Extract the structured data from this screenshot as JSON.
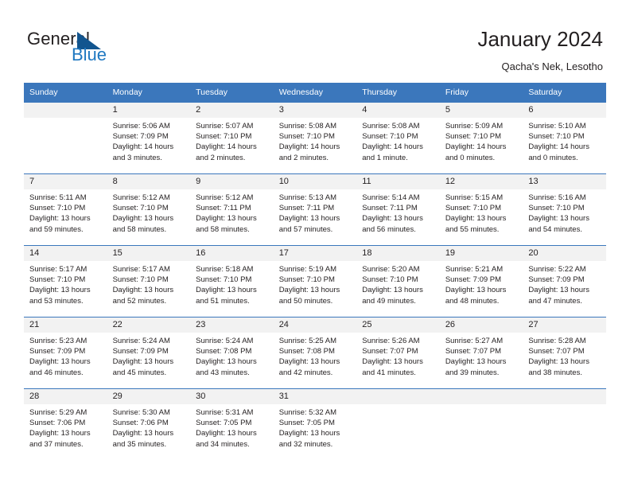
{
  "brand": {
    "word1": "General",
    "word2": "Blue",
    "triangle_color": "#12558f",
    "blue_color": "#1f78c1"
  },
  "header": {
    "title": "January 2024",
    "subtitle": "Qacha's Nek, Lesotho",
    "accent_color": "#3b77bc",
    "daynum_background": "#f2f2f2"
  },
  "weekdays": [
    "Sunday",
    "Monday",
    "Tuesday",
    "Wednesday",
    "Thursday",
    "Friday",
    "Saturday"
  ],
  "labels": {
    "sunrise_prefix": "Sunrise:",
    "sunset_prefix": "Sunset:",
    "daylight_prefix": "Daylight:"
  },
  "weeks": [
    [
      {
        "day": "",
        "empty": true
      },
      {
        "day": "1",
        "sunrise": "Sunrise: 5:06 AM",
        "sunset": "Sunset: 7:09 PM",
        "daylight": "Daylight: 14 hours and 3 minutes."
      },
      {
        "day": "2",
        "sunrise": "Sunrise: 5:07 AM",
        "sunset": "Sunset: 7:10 PM",
        "daylight": "Daylight: 14 hours and 2 minutes."
      },
      {
        "day": "3",
        "sunrise": "Sunrise: 5:08 AM",
        "sunset": "Sunset: 7:10 PM",
        "daylight": "Daylight: 14 hours and 2 minutes."
      },
      {
        "day": "4",
        "sunrise": "Sunrise: 5:08 AM",
        "sunset": "Sunset: 7:10 PM",
        "daylight": "Daylight: 14 hours and 1 minute."
      },
      {
        "day": "5",
        "sunrise": "Sunrise: 5:09 AM",
        "sunset": "Sunset: 7:10 PM",
        "daylight": "Daylight: 14 hours and 0 minutes."
      },
      {
        "day": "6",
        "sunrise": "Sunrise: 5:10 AM",
        "sunset": "Sunset: 7:10 PM",
        "daylight": "Daylight: 14 hours and 0 minutes."
      }
    ],
    [
      {
        "day": "7",
        "sunrise": "Sunrise: 5:11 AM",
        "sunset": "Sunset: 7:10 PM",
        "daylight": "Daylight: 13 hours and 59 minutes."
      },
      {
        "day": "8",
        "sunrise": "Sunrise: 5:12 AM",
        "sunset": "Sunset: 7:10 PM",
        "daylight": "Daylight: 13 hours and 58 minutes."
      },
      {
        "day": "9",
        "sunrise": "Sunrise: 5:12 AM",
        "sunset": "Sunset: 7:11 PM",
        "daylight": "Daylight: 13 hours and 58 minutes."
      },
      {
        "day": "10",
        "sunrise": "Sunrise: 5:13 AM",
        "sunset": "Sunset: 7:11 PM",
        "daylight": "Daylight: 13 hours and 57 minutes."
      },
      {
        "day": "11",
        "sunrise": "Sunrise: 5:14 AM",
        "sunset": "Sunset: 7:11 PM",
        "daylight": "Daylight: 13 hours and 56 minutes."
      },
      {
        "day": "12",
        "sunrise": "Sunrise: 5:15 AM",
        "sunset": "Sunset: 7:10 PM",
        "daylight": "Daylight: 13 hours and 55 minutes."
      },
      {
        "day": "13",
        "sunrise": "Sunrise: 5:16 AM",
        "sunset": "Sunset: 7:10 PM",
        "daylight": "Daylight: 13 hours and 54 minutes."
      }
    ],
    [
      {
        "day": "14",
        "sunrise": "Sunrise: 5:17 AM",
        "sunset": "Sunset: 7:10 PM",
        "daylight": "Daylight: 13 hours and 53 minutes."
      },
      {
        "day": "15",
        "sunrise": "Sunrise: 5:17 AM",
        "sunset": "Sunset: 7:10 PM",
        "daylight": "Daylight: 13 hours and 52 minutes."
      },
      {
        "day": "16",
        "sunrise": "Sunrise: 5:18 AM",
        "sunset": "Sunset: 7:10 PM",
        "daylight": "Daylight: 13 hours and 51 minutes."
      },
      {
        "day": "17",
        "sunrise": "Sunrise: 5:19 AM",
        "sunset": "Sunset: 7:10 PM",
        "daylight": "Daylight: 13 hours and 50 minutes."
      },
      {
        "day": "18",
        "sunrise": "Sunrise: 5:20 AM",
        "sunset": "Sunset: 7:10 PM",
        "daylight": "Daylight: 13 hours and 49 minutes."
      },
      {
        "day": "19",
        "sunrise": "Sunrise: 5:21 AM",
        "sunset": "Sunset: 7:09 PM",
        "daylight": "Daylight: 13 hours and 48 minutes."
      },
      {
        "day": "20",
        "sunrise": "Sunrise: 5:22 AM",
        "sunset": "Sunset: 7:09 PM",
        "daylight": "Daylight: 13 hours and 47 minutes."
      }
    ],
    [
      {
        "day": "21",
        "sunrise": "Sunrise: 5:23 AM",
        "sunset": "Sunset: 7:09 PM",
        "daylight": "Daylight: 13 hours and 46 minutes."
      },
      {
        "day": "22",
        "sunrise": "Sunrise: 5:24 AM",
        "sunset": "Sunset: 7:09 PM",
        "daylight": "Daylight: 13 hours and 45 minutes."
      },
      {
        "day": "23",
        "sunrise": "Sunrise: 5:24 AM",
        "sunset": "Sunset: 7:08 PM",
        "daylight": "Daylight: 13 hours and 43 minutes."
      },
      {
        "day": "24",
        "sunrise": "Sunrise: 5:25 AM",
        "sunset": "Sunset: 7:08 PM",
        "daylight": "Daylight: 13 hours and 42 minutes."
      },
      {
        "day": "25",
        "sunrise": "Sunrise: 5:26 AM",
        "sunset": "Sunset: 7:07 PM",
        "daylight": "Daylight: 13 hours and 41 minutes."
      },
      {
        "day": "26",
        "sunrise": "Sunrise: 5:27 AM",
        "sunset": "Sunset: 7:07 PM",
        "daylight": "Daylight: 13 hours and 39 minutes."
      },
      {
        "day": "27",
        "sunrise": "Sunrise: 5:28 AM",
        "sunset": "Sunset: 7:07 PM",
        "daylight": "Daylight: 13 hours and 38 minutes."
      }
    ],
    [
      {
        "day": "28",
        "sunrise": "Sunrise: 5:29 AM",
        "sunset": "Sunset: 7:06 PM",
        "daylight": "Daylight: 13 hours and 37 minutes."
      },
      {
        "day": "29",
        "sunrise": "Sunrise: 5:30 AM",
        "sunset": "Sunset: 7:06 PM",
        "daylight": "Daylight: 13 hours and 35 minutes."
      },
      {
        "day": "30",
        "sunrise": "Sunrise: 5:31 AM",
        "sunset": "Sunset: 7:05 PM",
        "daylight": "Daylight: 13 hours and 34 minutes."
      },
      {
        "day": "31",
        "sunrise": "Sunrise: 5:32 AM",
        "sunset": "Sunset: 7:05 PM",
        "daylight": "Daylight: 13 hours and 32 minutes."
      },
      {
        "day": "",
        "empty": true
      },
      {
        "day": "",
        "empty": true
      },
      {
        "day": "",
        "empty": true
      }
    ]
  ]
}
